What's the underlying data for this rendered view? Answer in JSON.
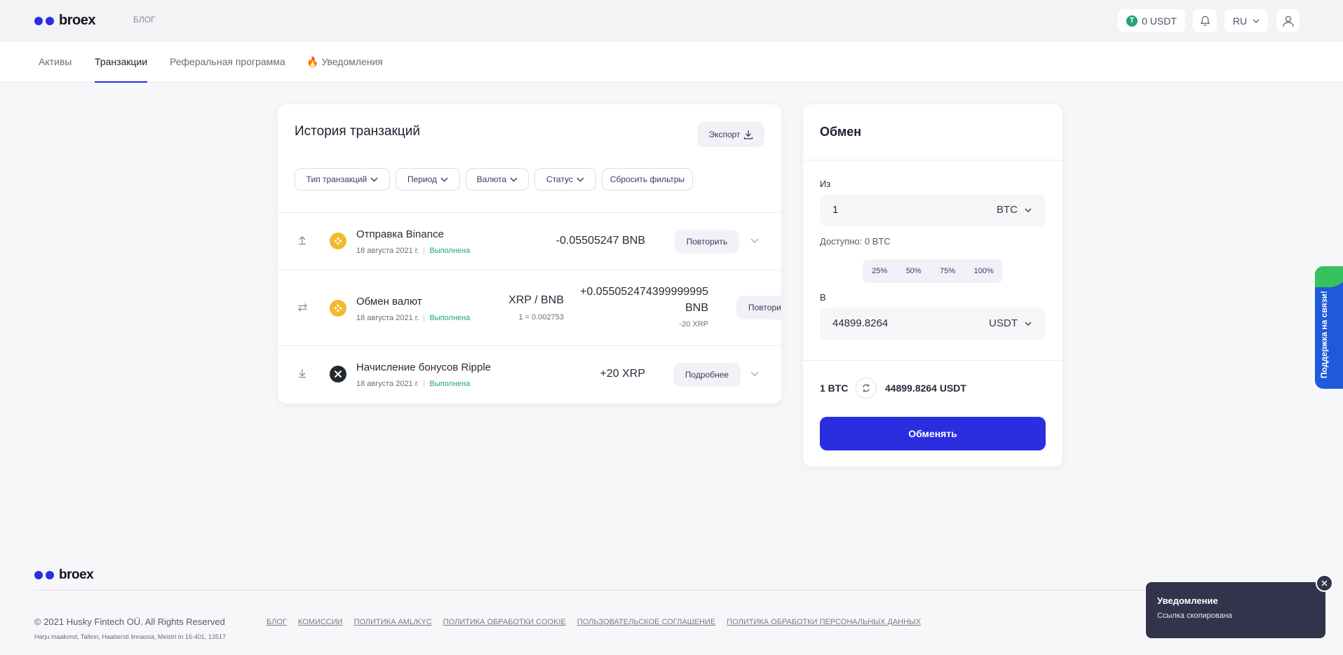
{
  "header": {
    "logo_text": "broex",
    "blog_label": "БЛОГ",
    "balance": "0 USDT",
    "lang": "RU"
  },
  "tabs": [
    {
      "label": "Активы"
    },
    {
      "label": "Транзакции"
    },
    {
      "label": "Реферальная программа"
    },
    {
      "label": "Уведомления"
    }
  ],
  "history": {
    "title": "История транзакций",
    "export_label": "Экспорт",
    "filters": [
      "Тип транзакций",
      "Период",
      "Валюта",
      "Статус"
    ],
    "reset_label": "Сбросить фильтры",
    "rows": [
      {
        "title": "Отправка Binance",
        "date": "18 августа 2021 г.",
        "status": "Выполнена",
        "amount": "-0.05505247 BNB",
        "action": "Повторить"
      },
      {
        "title": "Обмен валют",
        "date": "18 августа 2021 г.",
        "status": "Выполнена",
        "pair": "XRP / BNB",
        "rate": "1 = 0.002753",
        "amount_line1": "+0.055052474399999995",
        "amount_line2": "BNB",
        "sub_amount": "-20 XRP",
        "action": "Повтори"
      },
      {
        "title": "Начисление бонусов Ripple",
        "date": "18 августа 2021 г.",
        "status": "Выполнена",
        "amount": "+20 XRP",
        "action": "Подробнее"
      }
    ]
  },
  "exchange": {
    "title": "Обмен",
    "from_label": "Из",
    "from_value": "1",
    "from_currency": "BTC",
    "available": "Доступно: 0 BTC",
    "percents": [
      "25%",
      "50%",
      "75%",
      "100%"
    ],
    "to_label": "В",
    "to_value": "44899.8264",
    "to_currency": "USDT",
    "rate_from": "1 BTC",
    "rate_to": "44899.8264 USDT",
    "submit_label": "Обменять"
  },
  "support_label": "Поддержка на связи!",
  "footer": {
    "logo_text": "broex",
    "copyright": "© 2021 Husky Fintech OÜ. All Rights Reserved",
    "address": "Harju maakond, Tallinn, Haabersti linnaosa, Meistri tn 16-401, 13517",
    "links": [
      "БЛОГ",
      "КОМИССИИ",
      "ПОЛИТИКА AML/KYC",
      "ПОЛИТИКА ОБРАБОТКИ COOKIE",
      "ПОЛЬЗОВАТЕЛЬСКОЕ СОГЛАШЕНИЕ",
      "ПОЛИТИКА ОБРАБОТКИ ПЕРСОНАЛЬНЫХ ДАННЫХ"
    ]
  },
  "toast": {
    "title": "Уведомление",
    "message": "Ссылка скопирована"
  },
  "colors": {
    "brand": "#2a2ee0",
    "success": "#1fa86a",
    "bnb": "#f3ba2f",
    "xrp": "#23292f",
    "toast_bg": "#31344a"
  }
}
